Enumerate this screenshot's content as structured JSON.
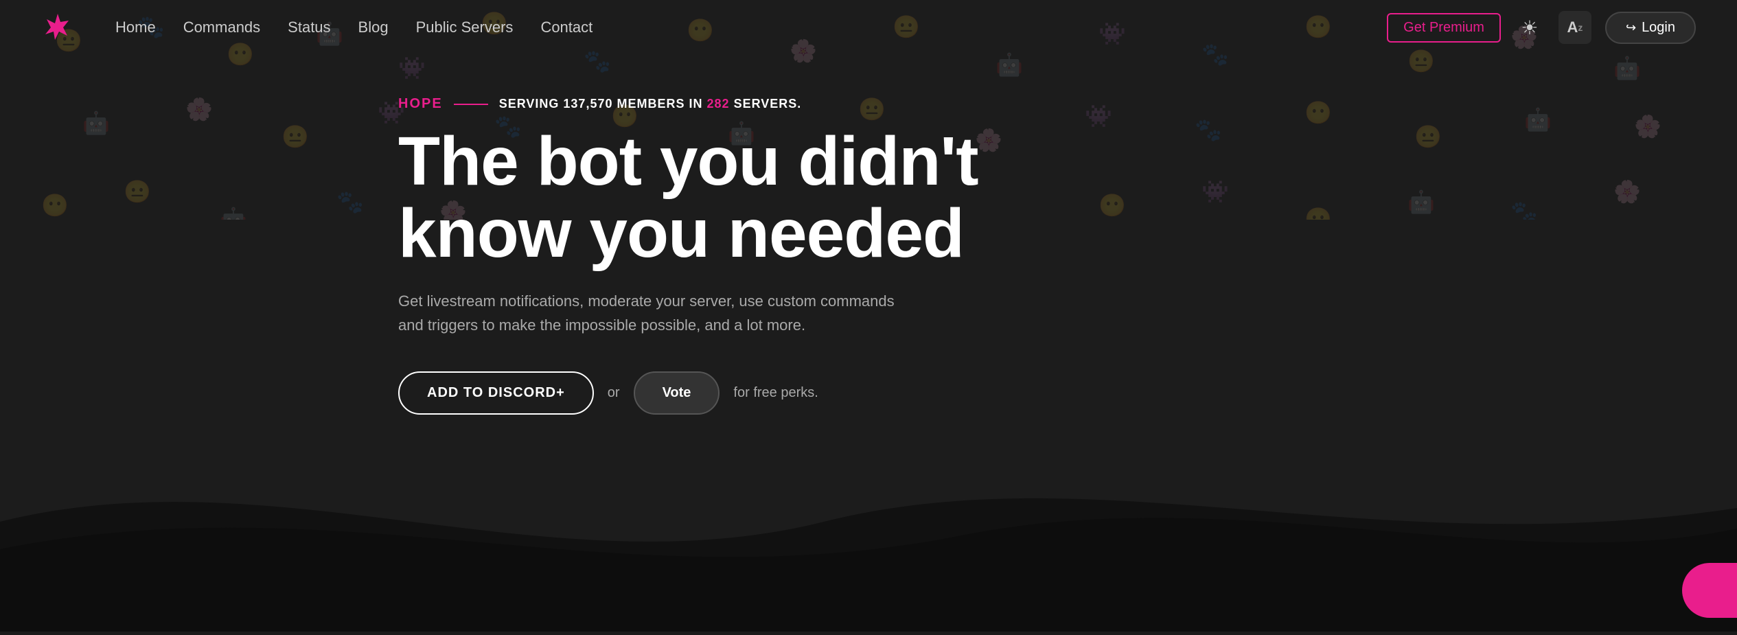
{
  "navbar": {
    "logo_alt": "Hope Bot Logo",
    "links": [
      {
        "label": "Home",
        "id": "home"
      },
      {
        "label": "Commands",
        "id": "commands"
      },
      {
        "label": "Status",
        "id": "status"
      },
      {
        "label": "Blog",
        "id": "blog"
      },
      {
        "label": "Public Servers",
        "id": "public-servers"
      },
      {
        "label": "Contact",
        "id": "contact"
      }
    ],
    "premium_label": "Get Premium",
    "login_label": "Login",
    "theme_icon": "☀",
    "lang_icon": "A"
  },
  "hero": {
    "tagline_brand": "HOPE",
    "tagline_separator": "——",
    "tagline_serving": "SERVING",
    "members_count": "137,570",
    "members_label": "MEMBERS IN",
    "servers_count": "282",
    "servers_label": "SERVERS.",
    "title_line1": "The bot you didn't",
    "title_line2": "know you needed",
    "subtitle": "Get livestream notifications, moderate your server, use custom commands and triggers to make the impossible possible, and a lot more.",
    "cta_discord": "ADD TO DISCORD+",
    "cta_or": "or",
    "cta_vote": "Vote",
    "cta_free_perks": "for free perks."
  }
}
